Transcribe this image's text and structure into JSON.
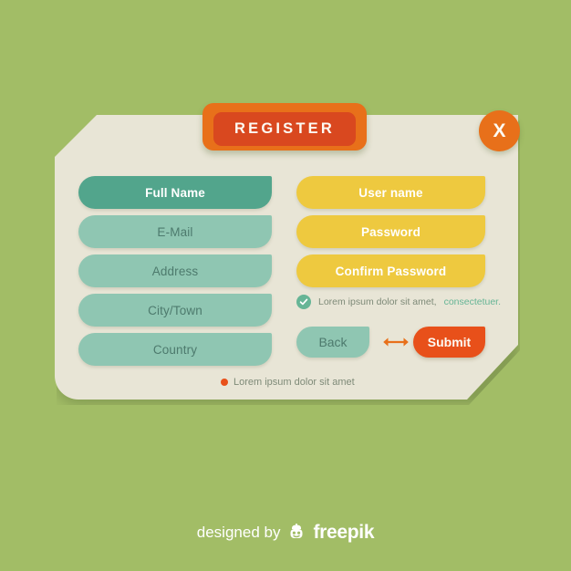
{
  "theme": {
    "background": "#a2bd66",
    "card": "#e8e5d6",
    "accent_orange": "#e8701a",
    "accent_red": "#d9481f",
    "submit_orange": "#e8501a",
    "teal_dark": "#52a58c",
    "teal_light": "#8fc6b2",
    "yellow": "#eec93f",
    "link_green": "#66b596",
    "muted_text": "#7e8a78"
  },
  "header": {
    "title": "REGISTER",
    "close_label": "X"
  },
  "form": {
    "left_fields": [
      {
        "label": "Full Name",
        "style": "teal-dark"
      },
      {
        "label": "E-Mail",
        "style": "teal-light"
      },
      {
        "label": "Address",
        "style": "teal-light"
      },
      {
        "label": "City/Town",
        "style": "teal-light"
      },
      {
        "label": "Country",
        "style": "teal-light"
      }
    ],
    "right_fields": [
      {
        "label": "User name",
        "style": "yellow"
      },
      {
        "label": "Password",
        "style": "yellow"
      },
      {
        "label": "Confirm Password",
        "style": "yellow"
      }
    ],
    "terms": {
      "text": "Lorem ipsum dolor sit amet,",
      "link": "consectetuer.",
      "checked": true,
      "check_icon": "check-icon"
    },
    "actions": {
      "back_label": "Back",
      "submit_label": "Submit",
      "arrow_icon": "double-arrow-icon"
    },
    "footnote": {
      "dot_icon": "bullet-dot-icon",
      "text": "Lorem ipsum dolor sit amet"
    }
  },
  "credit": {
    "designed_by": "designed by",
    "brand": "freepik",
    "logo_icon": "freepik-logo-icon"
  }
}
